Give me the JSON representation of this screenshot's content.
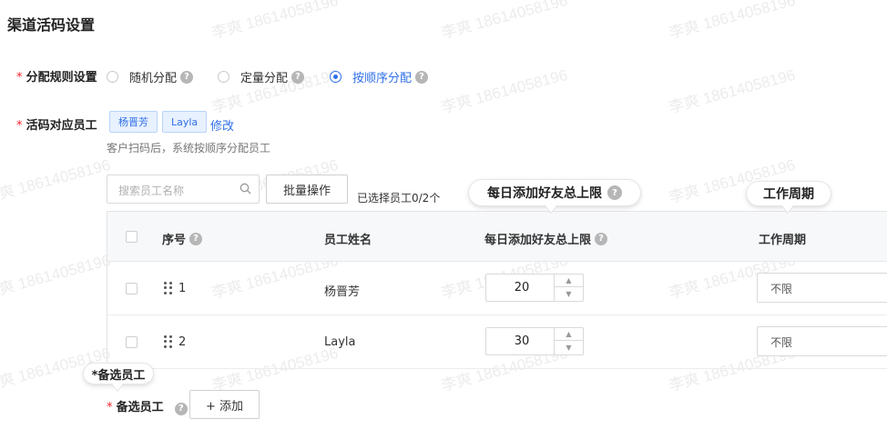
{
  "page": {
    "title": "渠道活码设置"
  },
  "watermark": {
    "text": "李爽 18614058196"
  },
  "allocation": {
    "required_mark": "*",
    "label": "分配规则设置",
    "options": [
      {
        "label": "随机分配",
        "checked": false
      },
      {
        "label": "定量分配",
        "checked": false
      },
      {
        "label": "按顺序分配",
        "checked": true
      }
    ],
    "help_icon": "question-circle-icon"
  },
  "staff": {
    "required_mark": "*",
    "label": "活码对应员工",
    "tags": [
      "杨晋芳",
      "Layla"
    ],
    "edit_link": "修改",
    "hint": "客户扫码后，系统按顺序分配员工"
  },
  "toolbar": {
    "search_placeholder": "搜索员工名称",
    "search_icon": "search-icon",
    "batch_button": "批量操作",
    "selected_text": "已选择员工0/2个"
  },
  "table": {
    "columns": {
      "index": "序号",
      "name": "员工姓名",
      "daily_limit": "每日添加好友总上限",
      "work_cycle": "工作周期"
    },
    "rows": [
      {
        "index": "1",
        "name": "杨晋芳",
        "daily_limit": "20",
        "work_cycle": "不限"
      },
      {
        "index": "2",
        "name": "Layla",
        "daily_limit": "30",
        "work_cycle": "不限"
      }
    ]
  },
  "callouts": {
    "daily_limit": "每日添加好友总上限",
    "work_cycle": "工作周期",
    "backup_staff": "*备选员工"
  },
  "backup": {
    "required_mark": "*",
    "label": "备选员工",
    "add_button": "+ 添加"
  },
  "colors": {
    "accent": "#2f6fe8",
    "required": "#f5222d"
  }
}
